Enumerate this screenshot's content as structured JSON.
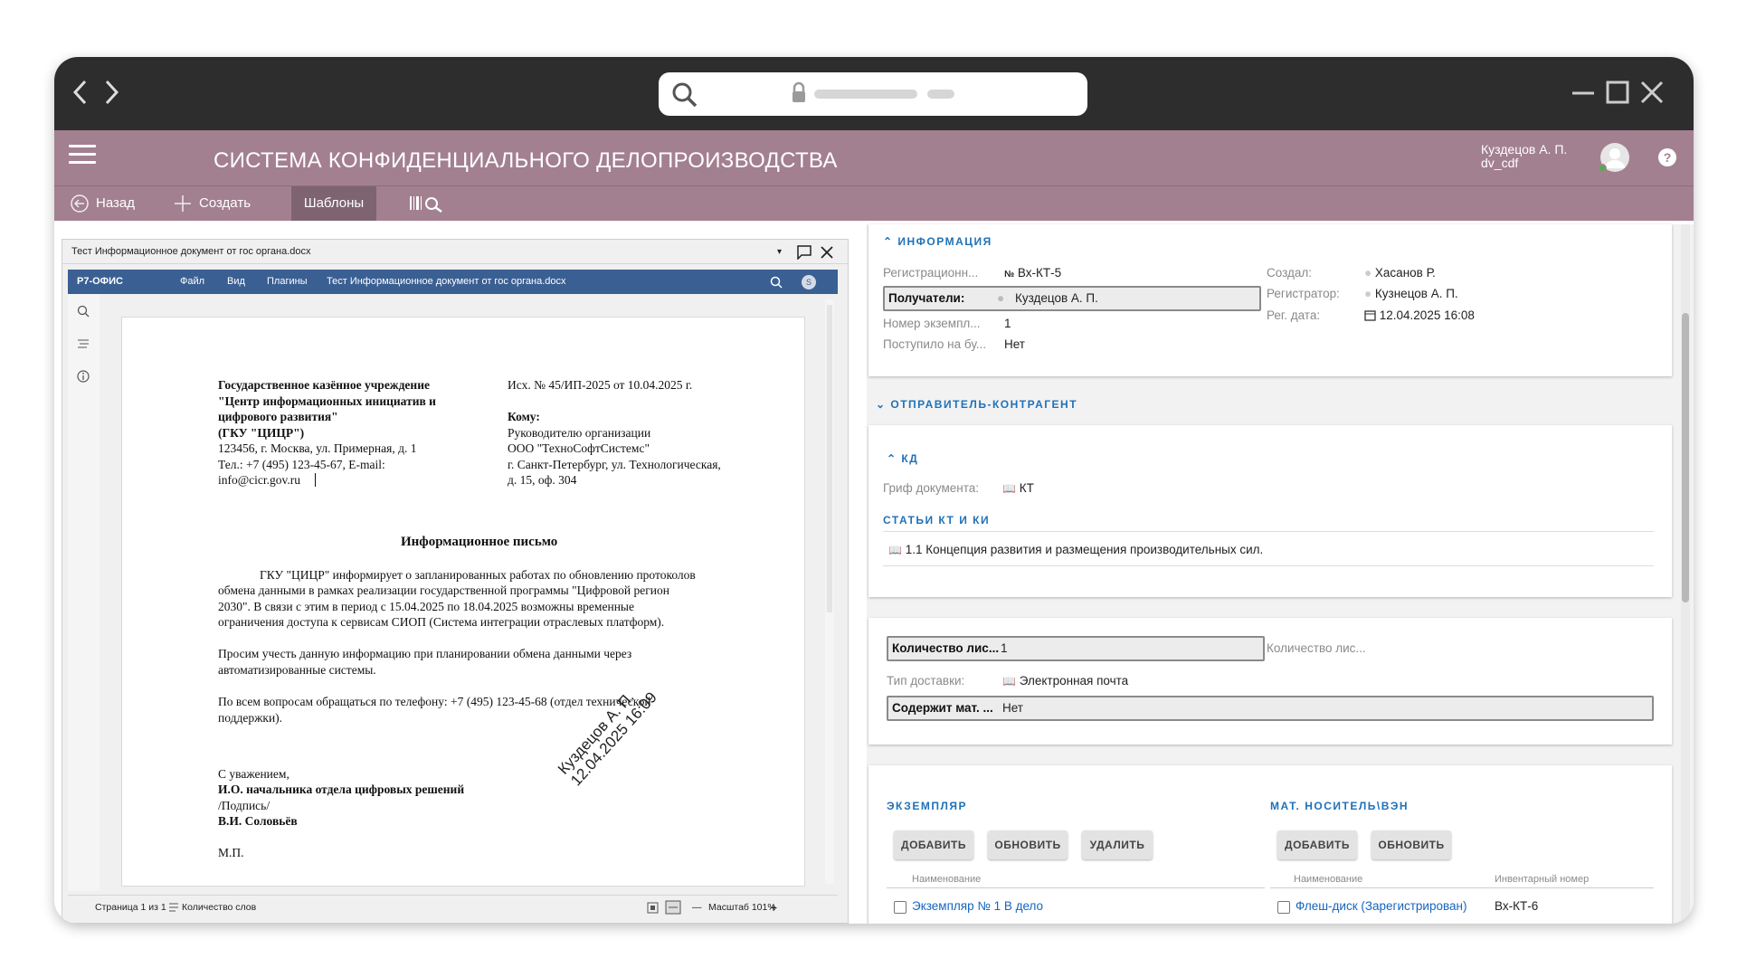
{
  "browser": {
    "back_icon": "chevron-left-icon",
    "forward_icon": "chevron-right-icon"
  },
  "app": {
    "title": "СИСТЕМА КОНФИДЕНЦИАЛЬНОГО ДЕЛОПРОИЗВОДСТВА",
    "user_name": "Куздецов А. П.",
    "user_login": "dv_cdf",
    "help_label": "?",
    "brand_color": "#a3808f"
  },
  "toolbar": {
    "back": "Назад",
    "create": "Создать",
    "templates": "Шаблоны"
  },
  "viewer": {
    "window_title": "Тест Информационное документ от гос органа.docx",
    "app_name": "Р7-ОФИС",
    "menu": [
      "Файл",
      "Вид",
      "Плагины"
    ],
    "doc_name": "Тест Информационное  документ от гос органа.docx",
    "avatar_letter": "S",
    "status_page": "Страница 1 из 1",
    "status_words": "Количество слов",
    "status_zoom": "Масштаб 101%"
  },
  "letter": {
    "sender": [
      "Государственное казённое учреждение",
      "\"Центр информационных инициатив и",
      "цифрового развития\"",
      "(ГКУ \"ЦИЦР\")"
    ],
    "sender_addr": [
      "123456, г. Москва, ул. Примерная, д. 1",
      "Тел.: +7 (495) 123-45-67, E-mail:",
      "info@cicr.gov.ru"
    ],
    "ref": "Исх. № 45/ИП-2025 от 10.04.2025 г.",
    "to_label": "Кому:",
    "to": [
      "Руководителю организации",
      "ООО \"ТехноСофтСистемс\"",
      "г. Санкт-Петербург, ул. Технологическая,",
      "д. 15, оф. 304"
    ],
    "heading": "Информационное письмо",
    "para1": [
      "ГКУ \"ЦИЦР\" информирует о запланированных работах по обновлению протоколов",
      "обмена данными в рамках реализации государственной программы \"Цифровой регион",
      "2030\". В связи с этим в период с 15.04.2025 по 18.04.2025 возможны временные",
      "ограничения доступа к сервисам СИОП (Система интеграции отраслевых платформ)."
    ],
    "para2": [
      "Просим учесть данную информацию при планировании обмена данными через",
      "автоматизированные системы."
    ],
    "para3": [
      "По всем вопросам обращаться по телефону: +7 (495) 123-45-68 (отдел технической",
      "поддержки)."
    ],
    "closing": "С уважением,",
    "sign_role": "И.О. начальника отдела цифровых решений",
    "sign_sub": "/Подпись/",
    "sign_name": "В.И. Соловьёв",
    "mp": "М.П.",
    "stamp_line1": "Куздецов А. П.",
    "stamp_line2": "12.04.2025 16:09"
  },
  "info": {
    "section": "ИНФОРМАЦИЯ",
    "reg_label": "Регистрационн...",
    "reg_value": "Вх-КТ-5",
    "recipients_label": "Получатели:",
    "recipients_value": "Куздецов А. П.",
    "copy_label": "Номер экземпл...",
    "copy_value": "1",
    "received_label": "Поступило на бу...",
    "received_value": "Нет",
    "created_label": "Создал:",
    "created_value": "Хасанов Р.",
    "registrar_label": "Регистратор:",
    "registrar_value": "Кузнецов А. П.",
    "regdate_label": "Рег. дата:",
    "regdate_value": "12.04.2025 16:08"
  },
  "sender_section": "ОТПРАВИТЕЛЬ-КОНТРАГЕНТ",
  "kd": {
    "section": "КД",
    "grif_label": "Гриф документа:",
    "grif_value": "КТ",
    "articles_section": "СТАТЬИ КТ И КИ",
    "article_1": "1.1 Концепция развития и размещения производительных сил."
  },
  "delivery": {
    "sheets_label": "Количество лис...",
    "sheets_value": "1",
    "sheets2_label": "Количество лис...",
    "type_label": "Тип доставки:",
    "type_value": "Электронная почта",
    "contains_label": "Содержит мат. ...",
    "contains_value": "Нет"
  },
  "copies": {
    "section": "ЭКЗЕМПЛЯР",
    "add": "ДОБАВИТЬ",
    "refresh": "ОБНОВИТЬ",
    "delete": "УДАЛИТЬ",
    "col_name": "Наименование",
    "row_1": "Экземпляр № 1 В дело"
  },
  "media": {
    "section": "МАТ. НОСИТЕЛЬ\\ВЭН",
    "add": "ДОБАВИТЬ",
    "refresh": "ОБНОВИТЬ",
    "col_name": "Наименование",
    "col_inv": "Инвентарный номер",
    "row_1_name": "Флеш-диск (Зарегистрирован)",
    "row_1_inv": "Вх-КТ-6"
  }
}
